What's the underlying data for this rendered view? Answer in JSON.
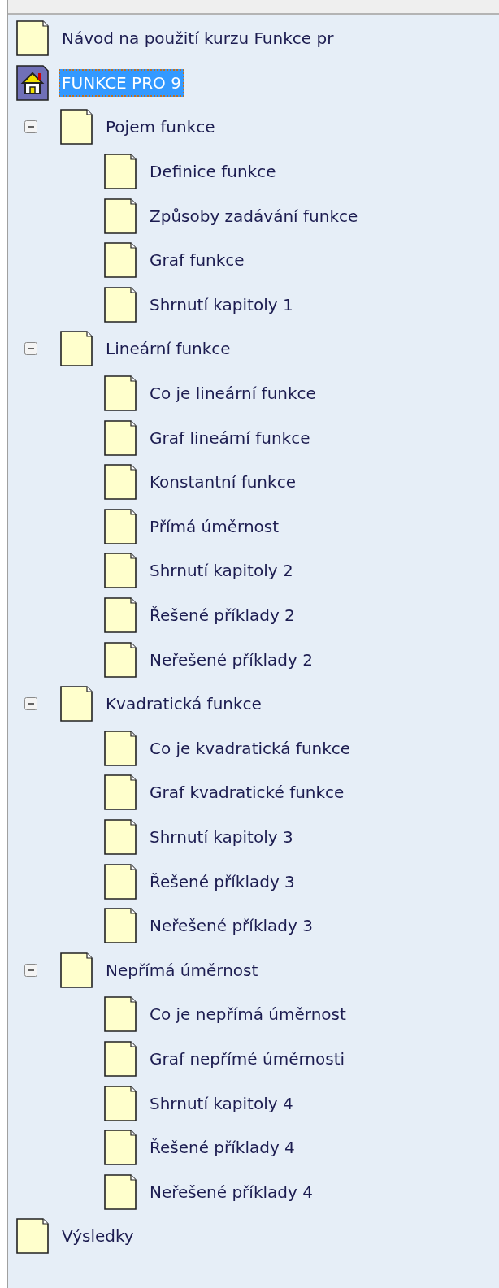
{
  "tree": [
    {
      "label": "Návod na použití kurzu Funkce pr",
      "kind": "page",
      "selected": false
    },
    {
      "label": "FUNKCE PRO 9",
      "kind": "home",
      "selected": true,
      "children": [
        {
          "label": "Pojem funkce",
          "kind": "page",
          "selected": false,
          "expanded": true,
          "children": [
            {
              "label": "Definice funkce",
              "kind": "page",
              "selected": false
            },
            {
              "label": "Způsoby zadávání funkce",
              "kind": "page",
              "selected": false
            },
            {
              "label": "Graf funkce",
              "kind": "page",
              "selected": false
            },
            {
              "label": "Shrnutí kapitoly 1",
              "kind": "page",
              "selected": false
            }
          ]
        },
        {
          "label": "Lineární funkce",
          "kind": "page",
          "selected": false,
          "expanded": true,
          "children": [
            {
              "label": "Co je lineární funkce",
              "kind": "page",
              "selected": false
            },
            {
              "label": "Graf lineární funkce",
              "kind": "page",
              "selected": false
            },
            {
              "label": "Konstantní funkce",
              "kind": "page",
              "selected": false
            },
            {
              "label": "Přímá úměrnost",
              "kind": "page",
              "selected": false
            },
            {
              "label": "Shrnutí kapitoly 2",
              "kind": "page",
              "selected": false
            },
            {
              "label": "Řešené příklady 2",
              "kind": "page",
              "selected": false
            },
            {
              "label": "Neřešené příklady 2",
              "kind": "page",
              "selected": false
            }
          ]
        },
        {
          "label": "Kvadratická funkce",
          "kind": "page",
          "selected": false,
          "expanded": true,
          "children": [
            {
              "label": "Co je kvadratická funkce",
              "kind": "page",
              "selected": false
            },
            {
              "label": "Graf kvadratické funkce",
              "kind": "page",
              "selected": false
            },
            {
              "label": "Shrnutí kapitoly 3",
              "kind": "page",
              "selected": false
            },
            {
              "label": "Řešené příklady 3",
              "kind": "page",
              "selected": false
            },
            {
              "label": "Neřešené příklady 3",
              "kind": "page",
              "selected": false
            }
          ]
        },
        {
          "label": "Nepřímá úměrnost",
          "kind": "page",
          "selected": false,
          "expanded": true,
          "children": [
            {
              "label": "Co je nepřímá úměrnost",
              "kind": "page",
              "selected": false
            },
            {
              "label": "Graf nepřímé úměrnosti",
              "kind": "page",
              "selected": false
            },
            {
              "label": "Shrnutí kapitoly 4",
              "kind": "page",
              "selected": false
            },
            {
              "label": "Řešené příklady 4",
              "kind": "page",
              "selected": false
            },
            {
              "label": "Neřešené příklady 4",
              "kind": "page",
              "selected": false
            }
          ]
        }
      ]
    },
    {
      "label": "Výsledky",
      "kind": "page",
      "selected": false
    }
  ]
}
